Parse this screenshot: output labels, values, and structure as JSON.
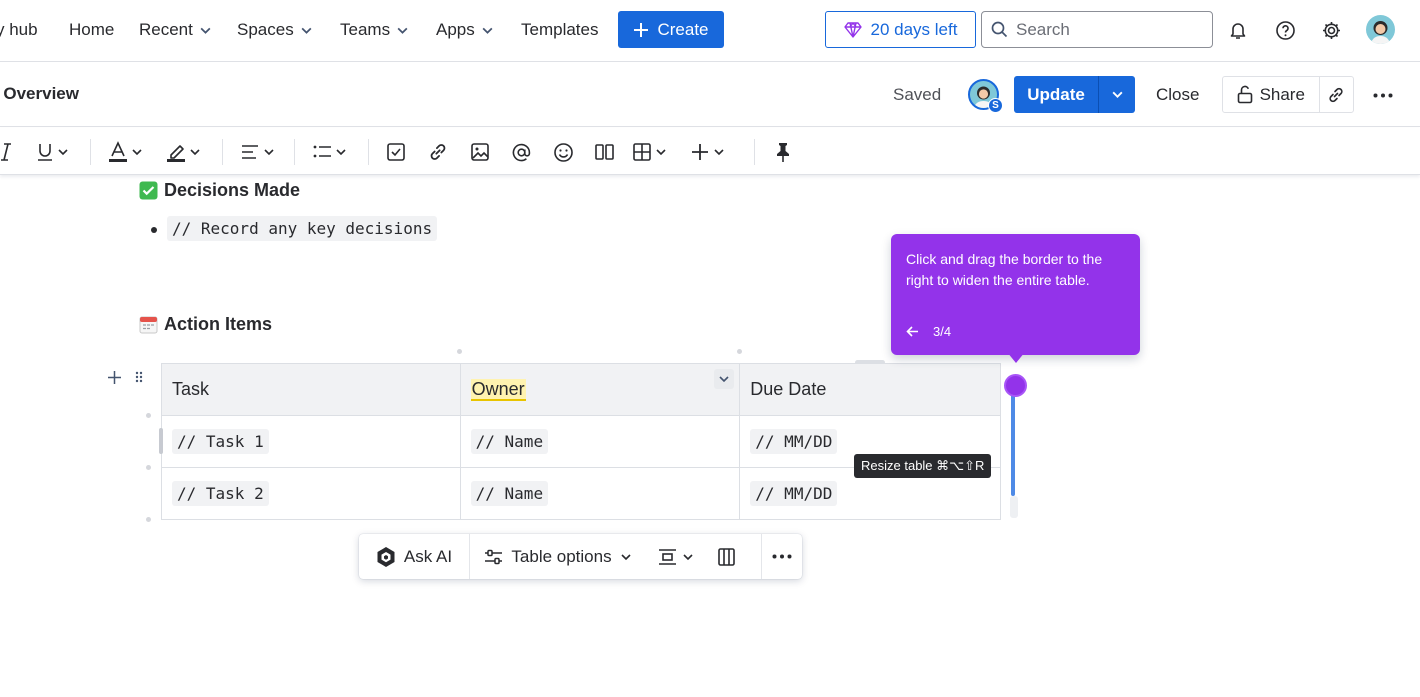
{
  "topnav": {
    "hub": "y hub",
    "home": "Home",
    "recent": "Recent",
    "spaces": "Spaces",
    "teams": "Teams",
    "apps": "Apps",
    "templates": "Templates",
    "create": "Create",
    "trial": "20 days left",
    "search_placeholder": "Search",
    "icons": [
      "bell-icon",
      "help-icon",
      "settings-icon",
      "user-avatar"
    ]
  },
  "page_header": {
    "title": "t Overview",
    "saved": "Saved",
    "collaborator_badge": "S",
    "update": "Update",
    "close": "Close",
    "share": "Share"
  },
  "toolbar": {
    "icons": [
      "italic-icon",
      "underline-icon",
      "text-color-icon",
      "highlight-icon",
      "align-icon",
      "list-icon",
      "task-icon",
      "link-icon",
      "image-icon",
      "mention-icon",
      "emoji-icon",
      "layout-icon",
      "table-icon",
      "insert-icon",
      "pin-icon"
    ]
  },
  "content": {
    "decisions_heading": "Decisions Made",
    "decisions_item": "// Record any key decisions",
    "action_heading": "Action Items",
    "table": {
      "headers": [
        "Task",
        "Owner",
        "Due Date"
      ],
      "rows": [
        [
          "// Task 1",
          "// Name",
          "// MM/DD"
        ],
        [
          "// Task 2",
          "// Name",
          "// MM/DD"
        ]
      ]
    }
  },
  "tooltip": {
    "message": "Click and drag the border to the right to widen the entire table.",
    "step": "3/4"
  },
  "resize_tip": "Resize table ⌘⌥⇧R",
  "table_bar": {
    "ask_ai": "Ask AI",
    "table_options": "Table options"
  },
  "colors": {
    "brand_blue": "#1868db",
    "tour_purple": "#9333ea",
    "resize_line": "#4e8ae6"
  }
}
